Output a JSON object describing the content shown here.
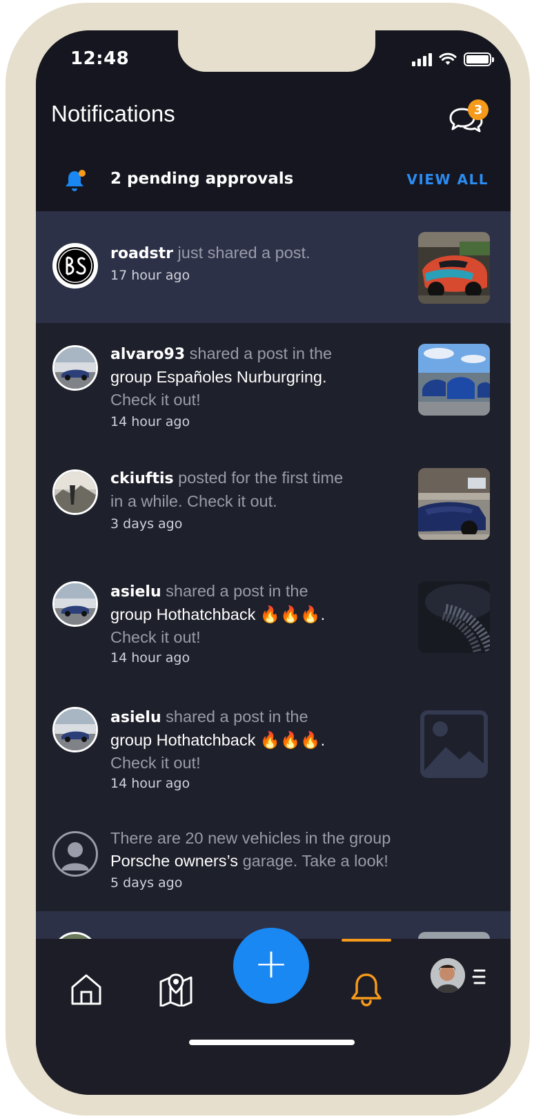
{
  "status_bar": {
    "time": "12:48"
  },
  "header": {
    "title": "Notifications",
    "chat_badge": "3"
  },
  "approvals": {
    "text": "2 pending approvals",
    "action": "VIEW ALL"
  },
  "notifications": [
    {
      "user": "roadstr",
      "text": " just shared a post.",
      "time": "17 hour ago"
    },
    {
      "user": "alvaro93",
      "text_1": " shared a post in the",
      "text_2": "group Españoles Nurburgring.",
      "text_3": "Check it out!",
      "time": "14 hour ago"
    },
    {
      "user": "ckiuftis",
      "text_1": " posted for the first time",
      "text_2": "in a while. Check it out.",
      "time": "3 days ago"
    },
    {
      "user": "asielu",
      "text_1": " shared a post in the",
      "text_2": "group Hothatchback 🔥🔥🔥.",
      "text_3": "Check it out!",
      "time": "14 hour ago"
    },
    {
      "user": "asielu",
      "text_1": " shared a post in the",
      "text_2": "group Hothatchback 🔥🔥🔥.",
      "text_3": "Check it out!",
      "time": "14 hour ago"
    },
    {
      "text_1": "There are 20 new vehicles in the group",
      "group": "Porsche owners’s",
      "text_2": " garage. Take a look!",
      "time": "5 days ago"
    }
  ],
  "icons": {
    "chat": "chat-bubbles-icon",
    "approvals": "bell-icon",
    "home": "home-icon",
    "map": "map-pin-icon",
    "add": "plus-icon",
    "notifications": "bell-icon",
    "menu": "menu-icon"
  },
  "colors": {
    "accent_blue": "#1a88f3",
    "accent_orange": "#f59a1b",
    "background": "#1e202b",
    "highlight": "#2d3147"
  }
}
